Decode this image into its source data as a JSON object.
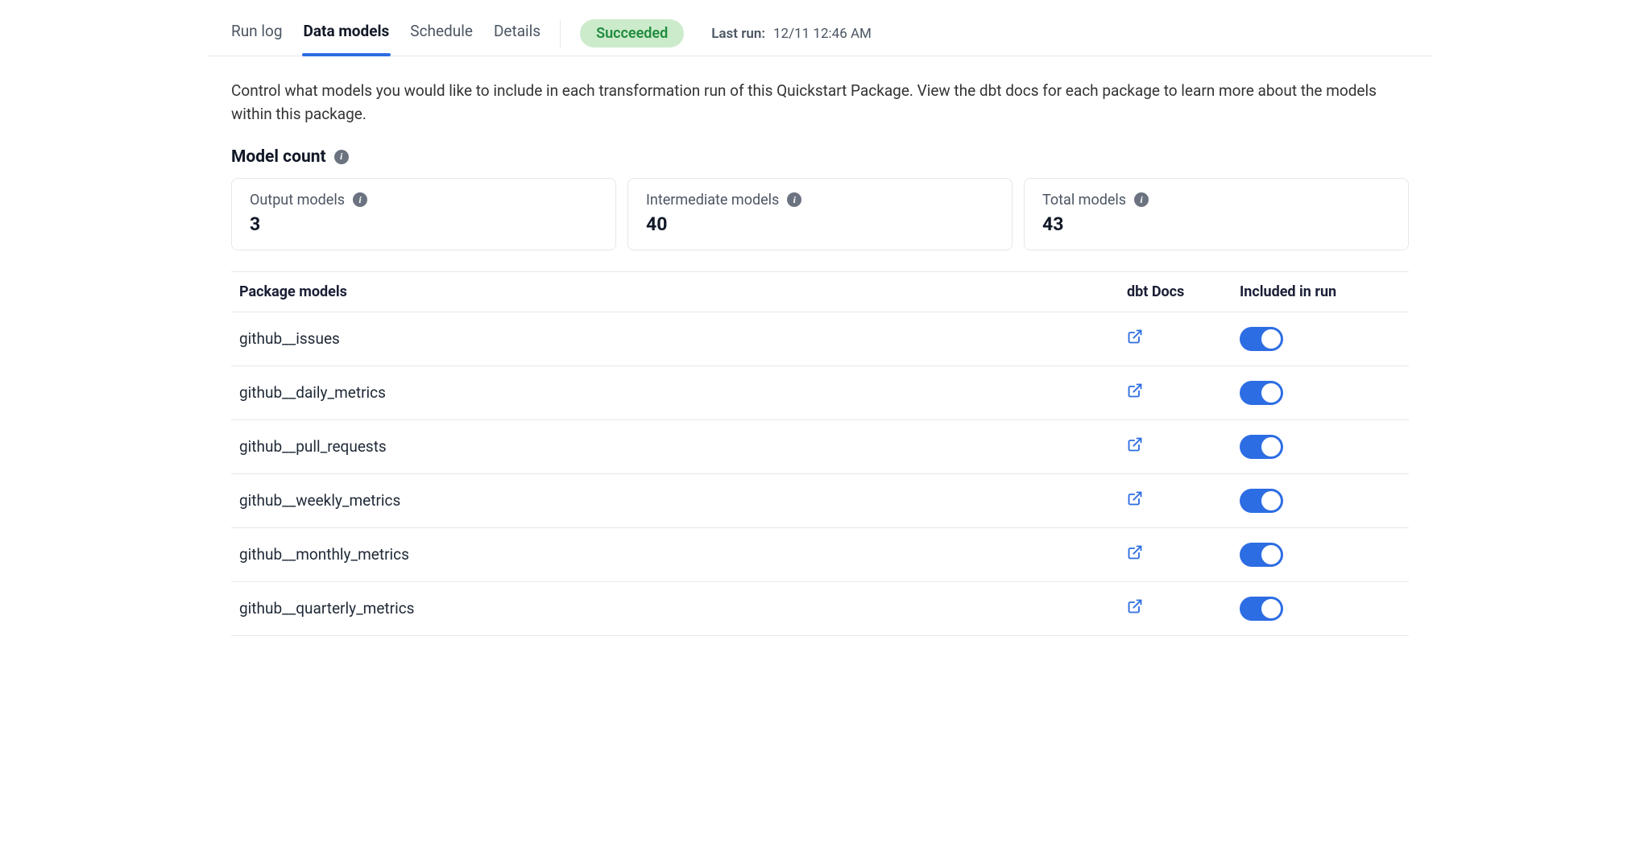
{
  "tabs": [
    {
      "label": "Run log",
      "active": false
    },
    {
      "label": "Data models",
      "active": true
    },
    {
      "label": "Schedule",
      "active": false
    },
    {
      "label": "Details",
      "active": false
    }
  ],
  "status": {
    "label": "Succeeded"
  },
  "last_run": {
    "label": "Last run:",
    "value": "12/11 12:46 AM"
  },
  "description": "Control what models you would like to include in each transformation run of this Quickstart Package. View the dbt docs for each package to learn more about the models within this package.",
  "model_count": {
    "title": "Model count",
    "cards": [
      {
        "label": "Output models",
        "value": "3"
      },
      {
        "label": "Intermediate models",
        "value": "40"
      },
      {
        "label": "Total models",
        "value": "43"
      }
    ]
  },
  "table": {
    "headers": {
      "name": "Package models",
      "docs": "dbt Docs",
      "include": "Included in run"
    },
    "rows": [
      {
        "name": "github__issues",
        "included": true
      },
      {
        "name": "github__daily_metrics",
        "included": true
      },
      {
        "name": "github__pull_requests",
        "included": true
      },
      {
        "name": "github__weekly_metrics",
        "included": true
      },
      {
        "name": "github__monthly_metrics",
        "included": true
      },
      {
        "name": "github__quarterly_metrics",
        "included": true
      }
    ]
  }
}
